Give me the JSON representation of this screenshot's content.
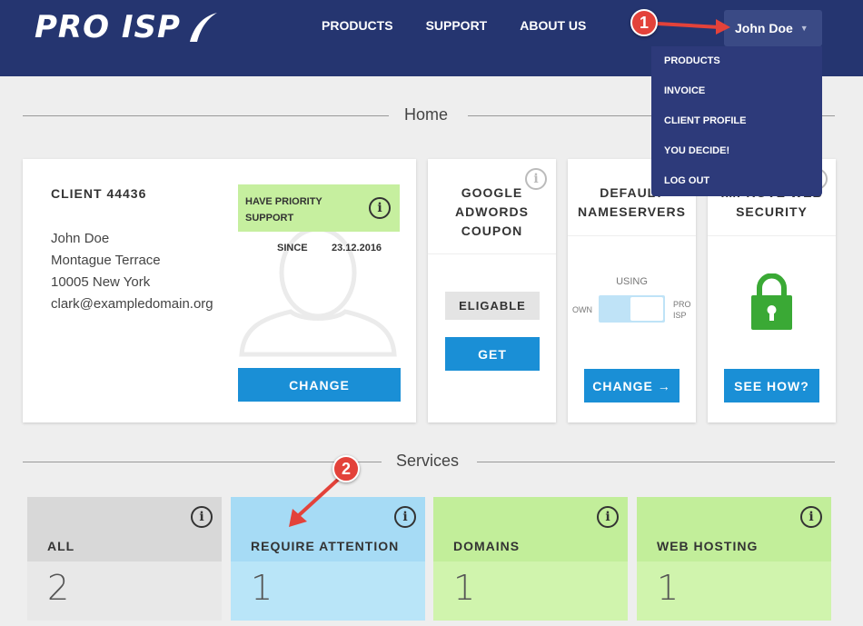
{
  "header": {
    "logo_text": "PRO ISP",
    "nav": [
      "PRODUCTS",
      "SUPPORT",
      "ABOUT US"
    ],
    "user_name": "John Doe",
    "dropdown": [
      "PRODUCTS",
      "INVOICE",
      "CLIENT PROFILE",
      "YOU DECIDE!",
      "LOG OUT"
    ]
  },
  "callouts": {
    "one": "1",
    "two": "2"
  },
  "home_section": {
    "title": "Home"
  },
  "client_card": {
    "title": "CLIENT 44436",
    "info": [
      "John Doe",
      "Montague Terrace",
      "10005 New York",
      "clark@exampledomain.org"
    ],
    "priority_label": "HAVE PRIORITY SUPPORT",
    "since_label": "SINCE",
    "since_date": "23.12.2016",
    "button": "CHANGE"
  },
  "adwords_card": {
    "title": "GOOGLE ADWORDS COUPON",
    "status": "ELIGABLE",
    "button": "GET"
  },
  "nameservers_card": {
    "title": "DEFAULT NAMESERVERS",
    "using_label": "USING",
    "left_label": "OWN",
    "right_label": "PRO ISP",
    "button": "CHANGE →"
  },
  "security_card": {
    "title": "IMPROVE WEB SECURITY",
    "button": "SEE HOW?"
  },
  "services_section": {
    "title": "Services"
  },
  "services": [
    {
      "label": "ALL",
      "count": "2"
    },
    {
      "label": "REQUIRE ATTENTION",
      "count": "1"
    },
    {
      "label": "DOMAINS",
      "count": "1"
    },
    {
      "label": "WEB HOSTING",
      "count": "1"
    }
  ],
  "colors": {
    "header_bg": "#253570",
    "accent_blue": "#1a8fd6",
    "callout_red": "#e3423a",
    "green_tile": "#c6ef9f",
    "blue_tile": "#b0e0f6",
    "grey_tile": "#d8d8d8",
    "lock_green": "#3aa935"
  },
  "icons": [
    "info-icon",
    "lock-icon",
    "user-silhouette-icon",
    "caret-down-icon",
    "logo-swoosh-icon"
  ]
}
